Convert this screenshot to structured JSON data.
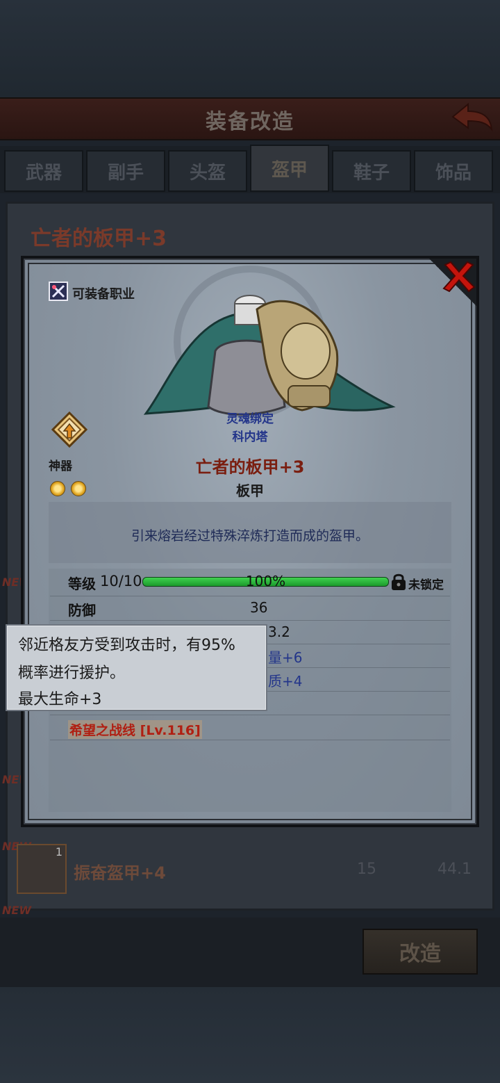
{
  "header": {
    "title": "装备改造"
  },
  "tabs": [
    {
      "label": "武器",
      "active": false
    },
    {
      "label": "副手",
      "active": false
    },
    {
      "label": "头盔",
      "active": false
    },
    {
      "label": "盔甲",
      "active": true
    },
    {
      "label": "鞋子",
      "active": false
    },
    {
      "label": "饰品",
      "active": false
    }
  ],
  "background_list": {
    "title": "亡者的板甲+3",
    "new_badge": "NEW",
    "row": {
      "name": "振奋盔甲+4",
      "level": "1",
      "value1": "15",
      "value2": "44.1"
    }
  },
  "footer": {
    "modify_button": "改造"
  },
  "modal": {
    "class_label": "可装备职业",
    "soul_bind": "灵魂绑定",
    "bound_to": "科内塔",
    "artifact_label": "神器",
    "item_name": "亡者的板甲+3",
    "item_type": "板甲",
    "description": "引来熔岩经过特殊淬炼打造而成的盔甲。",
    "level": {
      "label": "等级",
      "value": "10/10",
      "percent": "100%",
      "progress": 1.0,
      "lock_label": "未锁定"
    },
    "stats": [
      {
        "label": "防御",
        "value": "36"
      },
      {
        "value": "3.2"
      },
      {
        "value": "量+6"
      },
      {
        "value": "质+4"
      }
    ],
    "set_name": "希望之战线",
    "set_level": "[Lv.116]"
  },
  "tooltip": {
    "line1": "邻近格友方受到攻击时，有95%",
    "line2": "概率进行援护。",
    "line3": "最大生命+3"
  },
  "colors": {
    "item_name": "#7a1e10",
    "bind_text": "#23358a",
    "progress_fill": "#2fbf3f",
    "set_name": "#b01f12"
  }
}
